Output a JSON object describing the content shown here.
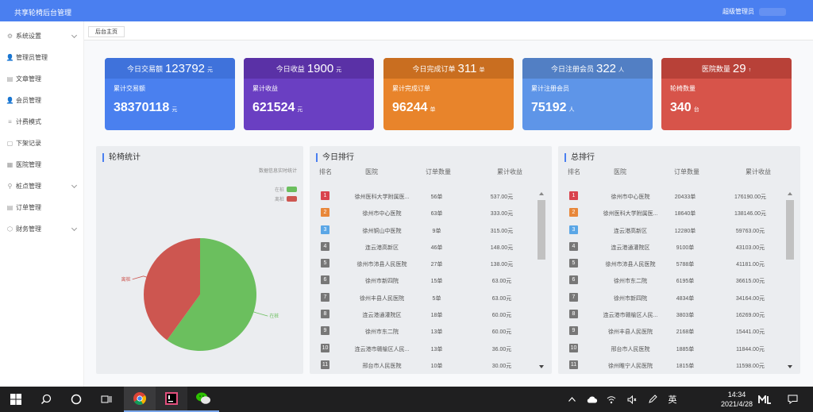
{
  "app": {
    "title": "共享轮椅后台管理",
    "user_label": "超级管理员"
  },
  "sidebar": {
    "items": [
      {
        "label": "系统设置",
        "icon": "gear-icon",
        "glyph": "⚙",
        "expandable": true
      },
      {
        "label": "管理员管理",
        "icon": "user-icon",
        "glyph": "👤",
        "expandable": false
      },
      {
        "label": "文章管理",
        "icon": "document-icon",
        "glyph": "▤",
        "expandable": false
      },
      {
        "label": "会员管理",
        "icon": "user-icon",
        "glyph": "👤",
        "expandable": false
      },
      {
        "label": "计费模式",
        "icon": "list-icon",
        "glyph": "≡",
        "expandable": false
      },
      {
        "label": "下架记录",
        "icon": "document-icon",
        "glyph": "▢",
        "expandable": false
      },
      {
        "label": "医院管理",
        "icon": "building-icon",
        "glyph": "▦",
        "expandable": false
      },
      {
        "label": "桩点管理",
        "icon": "location-icon",
        "glyph": "⚲",
        "expandable": true
      },
      {
        "label": "订单管理",
        "icon": "order-icon",
        "glyph": "▤",
        "expandable": false
      },
      {
        "label": "财务管理",
        "icon": "finance-icon",
        "glyph": "⬡",
        "expandable": true
      }
    ]
  },
  "tabs": [
    {
      "label": "后台主页"
    }
  ],
  "cards": [
    {
      "head_label": "今日交易额",
      "head_value": "123792",
      "head_unit": "元",
      "sub_label": "累计交易额",
      "total": "38370118",
      "total_unit": "元",
      "color": "#4a80ef",
      "head_color": "#3f72db"
    },
    {
      "head_label": "今日收益",
      "head_value": "1900",
      "head_unit": "元",
      "sub_label": "累计收益",
      "total": "621524",
      "total_unit": "元",
      "color": "#6a3fc2",
      "head_color": "#5a31a6"
    },
    {
      "head_label": "今日完成订单",
      "head_value": "311",
      "head_unit": "单",
      "sub_label": "累计完成订单",
      "total": "96244",
      "total_unit": "单",
      "color": "#e8842b",
      "head_color": "#c96e20"
    },
    {
      "head_label": "今日注册会员",
      "head_value": "322",
      "head_unit": "人",
      "sub_label": "累计注册会员",
      "total": "75192",
      "total_unit": "人",
      "color": "#5e95e8",
      "head_color": "#527fc4"
    },
    {
      "head_label": "医院数量",
      "head_value": "29",
      "head_unit": "↑",
      "sub_label": "轮椅数量",
      "total": "340",
      "total_unit": "台",
      "color": "#d7544a",
      "head_color": "#b84138"
    }
  ],
  "pie_panel": {
    "title": "轮椅统计",
    "subtitle": "数据信息实时统计"
  },
  "chart_data": {
    "type": "pie",
    "title": "轮椅统计",
    "subtitle": "数据信息实时统计",
    "legend_position": "top-right",
    "slices": [
      {
        "name": "在桩",
        "value": 60,
        "color": "#6bbf5e"
      },
      {
        "name": "离桩",
        "value": 40,
        "color": "#cd5650"
      }
    ]
  },
  "today_rank": {
    "title": "今日排行",
    "headers": [
      "排名",
      "医院",
      "订单数量",
      "累计收益"
    ],
    "rows": [
      [
        "1",
        "徐州医科大学附属医...",
        "56单",
        "537.00元"
      ],
      [
        "2",
        "徐州市中心医院",
        "63单",
        "333.00元"
      ],
      [
        "3",
        "徐州铜山中医院",
        "9单",
        "315.00元"
      ],
      [
        "4",
        "连云港高新区",
        "46单",
        "148.00元"
      ],
      [
        "5",
        "徐州市沛县人民医院",
        "27单",
        "138.00元"
      ],
      [
        "6",
        "徐州市新四院",
        "15单",
        "63.00元"
      ],
      [
        "7",
        "徐州丰县人民医院",
        "5单",
        "63.00元"
      ],
      [
        "8",
        "连云港通灌院区",
        "18单",
        "60.00元"
      ],
      [
        "9",
        "徐州市东二院",
        "13单",
        "60.00元"
      ],
      [
        "10",
        "连云港市赣榆区人民...",
        "13单",
        "36.00元"
      ],
      [
        "11",
        "邢台市人民医院",
        "10单",
        "30.00元"
      ]
    ]
  },
  "total_rank": {
    "title": "总排行",
    "headers": [
      "排名",
      "医院",
      "订单数量",
      "累计收益"
    ],
    "rows": [
      [
        "1",
        "徐州市中心医院",
        "20433单",
        "176190.00元"
      ],
      [
        "2",
        "徐州医科大学附属医...",
        "18640单",
        "138146.00元"
      ],
      [
        "3",
        "连云港高新区",
        "12280单",
        "59763.00元"
      ],
      [
        "4",
        "连云港通灌院区",
        "9100单",
        "43103.00元"
      ],
      [
        "5",
        "徐州市沛县人民医院",
        "5788单",
        "41181.00元"
      ],
      [
        "6",
        "徐州市东二院",
        "6195单",
        "36615.00元"
      ],
      [
        "7",
        "徐州市新四院",
        "4834单",
        "34164.00元"
      ],
      [
        "8",
        "连云港市赣榆区人民...",
        "3803单",
        "16269.00元"
      ],
      [
        "9",
        "徐州丰县人民医院",
        "2168单",
        "15441.00元"
      ],
      [
        "10",
        "邢台市人民医院",
        "1885单",
        "11844.00元"
      ],
      [
        "11",
        "徐州睢宁人民医院",
        "1815单",
        "11598.00元"
      ]
    ]
  },
  "badge_colors": [
    "#d9434e",
    "#e8873a",
    "#5aa6e6",
    "#777777"
  ],
  "taskbar": {
    "time": "14:34",
    "date": "2021/4/28",
    "ime": "英",
    "icons": [
      "windows-icon",
      "search-icon",
      "task-view-icon",
      "multitask-icon",
      "chrome-icon",
      "jetbrains-icon",
      "wechat-icon"
    ],
    "tray": [
      "chevron-up-icon",
      "cloud-icon",
      "wifi-icon",
      "volume-icon",
      "pen-icon",
      "ime-indicator",
      "app-icon",
      "notification-icon"
    ]
  }
}
